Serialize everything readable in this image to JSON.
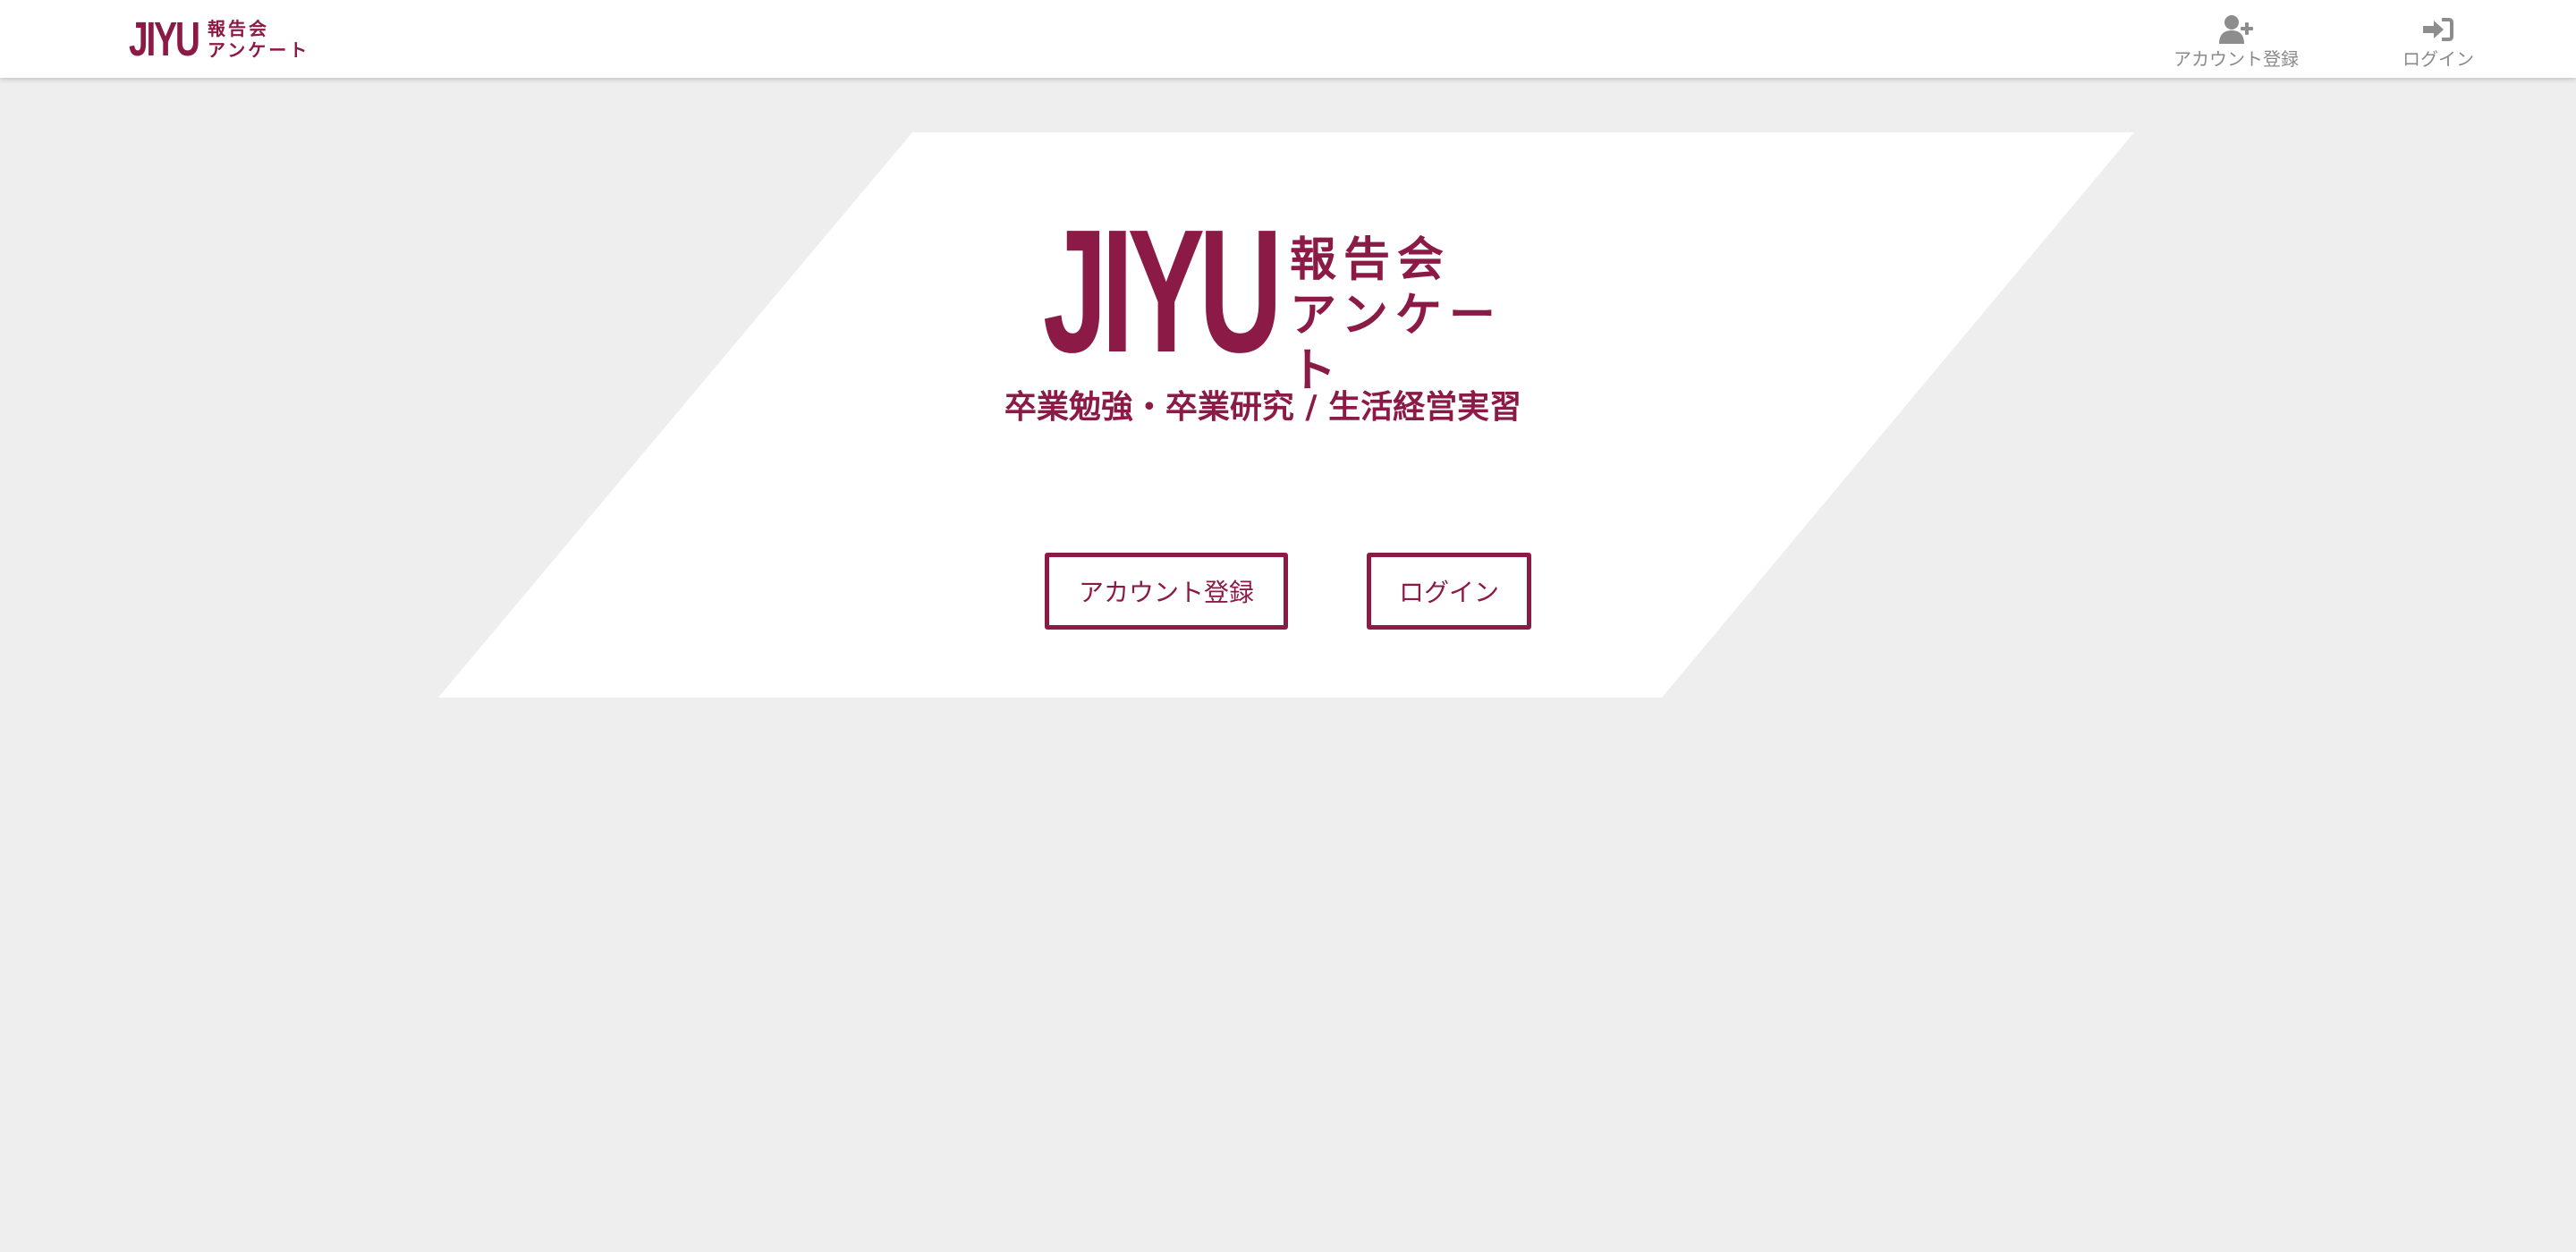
{
  "header": {
    "brand": {
      "word": "JIYU",
      "sub_line1": "報告会",
      "sub_line2": "アンケート"
    },
    "nav": [
      {
        "label": "アカウント登録",
        "icon": "user-plus-icon"
      },
      {
        "label": "ログイン",
        "icon": "sign-in-icon"
      }
    ]
  },
  "hero": {
    "logo_word": "JIYU",
    "logo_sub_line1": "報告会",
    "logo_sub_line2": "アンケート",
    "tagline": "卒業勉強・卒業研究 / 生活経営実習",
    "buttons": {
      "register": "アカウント登録",
      "login": "ログイン"
    }
  },
  "colors": {
    "brand": "#8b1a46",
    "background": "#eeeeee",
    "panel": "#ffffff",
    "nav_text": "#8a8a8a"
  }
}
